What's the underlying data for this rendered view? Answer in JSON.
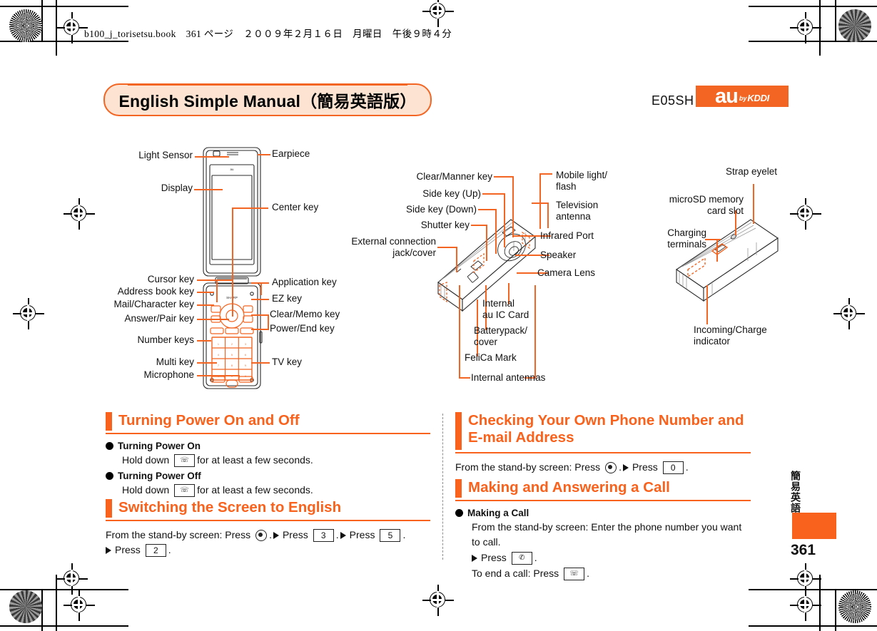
{
  "print_header": {
    "text": "b100_j_torisetsu.book　361 ページ　２００９年２月１６日　月曜日　午後９時４分"
  },
  "title_banner": {
    "text": "English Simple Manual（簡易英語版）"
  },
  "model": {
    "code": "E05SH",
    "logo_au": "au",
    "logo_by": "by",
    "logo_kddi": "KDDI"
  },
  "diagrams": {
    "front": {
      "left_labels": [
        "Light Sensor",
        "Display",
        "Cursor key",
        "Address book key",
        "Mail/Character key",
        "Answer/Pair key",
        "Number keys",
        "Multi key",
        "Microphone"
      ],
      "right_labels": [
        "Earpiece",
        "Center key",
        "Application key",
        "EZ key",
        "Clear/Memo key",
        "Power/End key",
        "TV key"
      ],
      "screen_brand": "SHARP",
      "screen_logo": "au"
    },
    "back": {
      "left_labels": [
        "Clear/Manner key",
        "Side key (Up)",
        "Side key (Down)",
        "Shutter key",
        "External connection\njack/cover"
      ],
      "right_labels": [
        "Mobile light/\nflash",
        "Television\nantenna",
        "Infrared Port",
        "Speaker",
        "Camera Lens"
      ],
      "bottom_labels": [
        "Internal\nau IC Card",
        "Batterypack/\ncover",
        "FeliCa Mark",
        "Internal antennas"
      ]
    },
    "side": {
      "labels": [
        "Strap eyelet",
        "microSD memory\ncard slot",
        "Charging terminals",
        "Incoming/Charge\nindicator"
      ]
    }
  },
  "sections": {
    "power": {
      "heading": "Turning Power On and Off",
      "items": [
        {
          "bullet": "Turning Power On",
          "line_pre": "Hold down",
          "key": "end",
          "line_post": "for at least a few seconds."
        },
        {
          "bullet": "Turning Power Off",
          "line_pre": "Hold down",
          "key": "end",
          "line_post": "for at least a few seconds."
        }
      ]
    },
    "switch_english": {
      "heading": "Switching the Screen to English",
      "line1_pre": "From the stand-by screen: Press",
      "line1_keys": [
        "center",
        "3",
        "5"
      ],
      "line2_key": "2",
      "press_label": "Press"
    },
    "check_number": {
      "heading": "Checking Your Own Phone Number and E-mail Address",
      "line_pre": "From the stand-by screen: Press",
      "keys": [
        "center",
        "0"
      ],
      "press_label": "Press"
    },
    "making_call": {
      "heading": "Making and Answering a Call",
      "bullet": "Making a Call",
      "line1": "From the stand-by screen: Enter the phone number you want to call.",
      "line2_press": "Press",
      "line2_key": "send",
      "line3_pre": "To end a call: Press",
      "line3_key": "end"
    }
  },
  "footer": {
    "vertical_tab": "簡易英語",
    "page_number": "361"
  },
  "colors": {
    "accent_orange": "#F8621C",
    "banner_fill": "#FCE3D2",
    "banner_border": "#F26522"
  }
}
